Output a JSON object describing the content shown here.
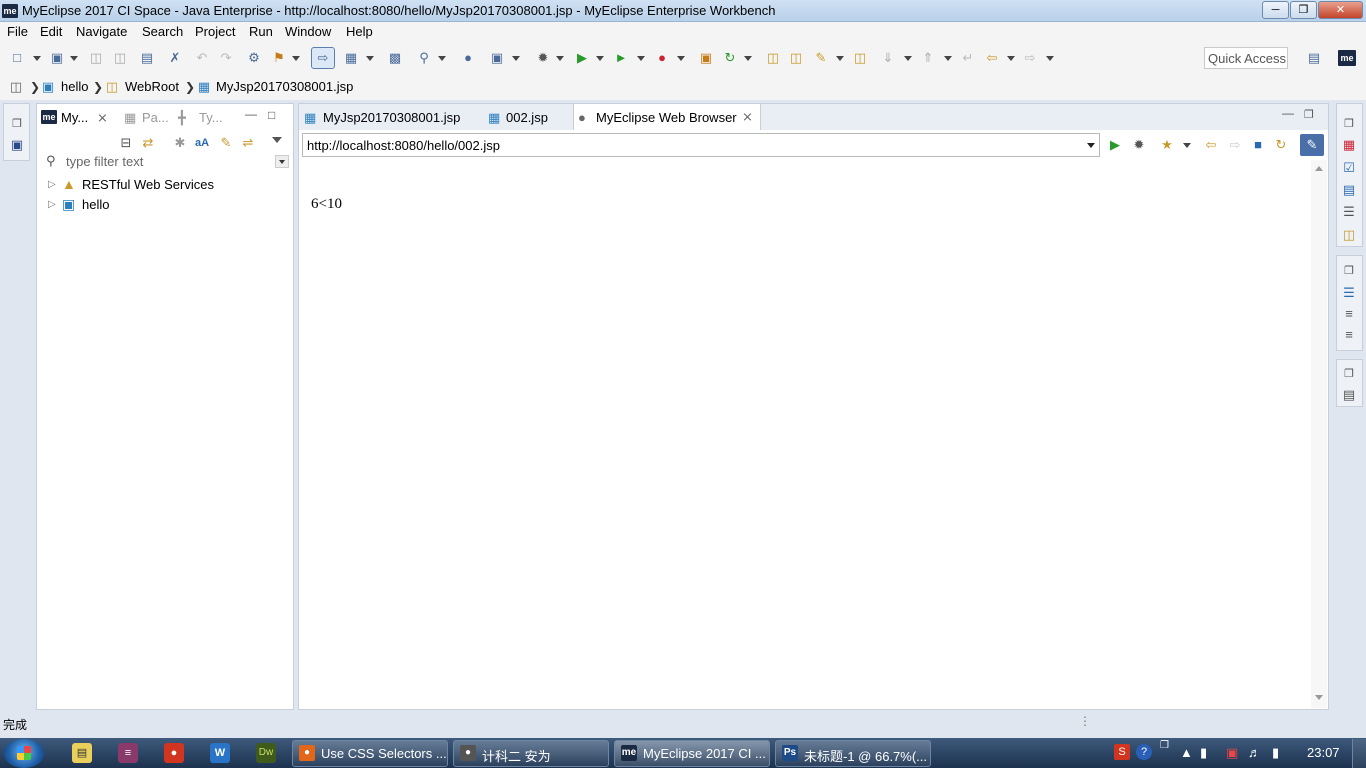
{
  "window": {
    "title": "MyEclipse 2017 CI Space - Java Enterprise - http://localhost:8080/hello/MyJsp20170308001.jsp - MyEclipse Enterprise Workbench",
    "logo": "me"
  },
  "menu": [
    "File",
    "Edit",
    "Navigate",
    "Search",
    "Project",
    "Run",
    "Window",
    "Help"
  ],
  "toolbar": {
    "quick_access": "Quick Access",
    "icons": [
      "new-icon",
      "save-icon",
      "run-icon",
      "debug-icon",
      "back-icon",
      "forward-icon"
    ]
  },
  "breadcrumb": {
    "items": [
      "hello",
      "WebRoot",
      "MyJsp20170308001.jsp"
    ]
  },
  "explorer": {
    "tabs": [
      "My...",
      "Pa...",
      "Ty..."
    ],
    "filter_placeholder": "type filter text",
    "tree": [
      "RESTful Web Services",
      "hello"
    ]
  },
  "editor": {
    "tabs": [
      "MyJsp20170308001.jsp",
      "002.jsp",
      "MyEclipse Web Browser"
    ],
    "active_tab": "MyEclipse Web Browser",
    "url": "http://localhost:8080/hello/002.jsp",
    "content": "6<10"
  },
  "status": {
    "text": "完成"
  },
  "taskbar": {
    "items": [
      "Use CSS Selectors ...",
      "计科二 安为",
      "MyEclipse 2017 CI ...",
      "未标题-1 @ 66.7%(..."
    ],
    "active_index": 2,
    "clock": "23:07"
  },
  "colors": {
    "accent": "#3a6ea5",
    "taskbar": "#1c324f"
  }
}
